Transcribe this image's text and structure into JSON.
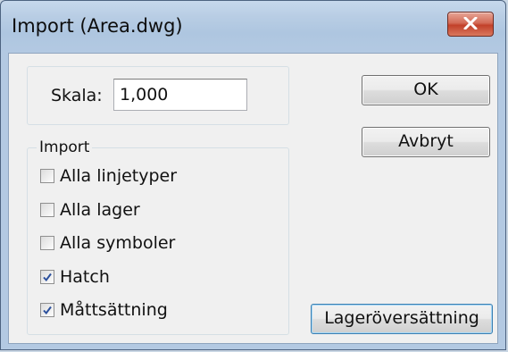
{
  "window": {
    "title": "Import (Area.dwg)"
  },
  "scale": {
    "label": "Skala:",
    "value": "1,000"
  },
  "import_group": {
    "legend": "Import",
    "options": [
      {
        "label": "Alla linjetyper",
        "checked": false
      },
      {
        "label": "Alla lager",
        "checked": false
      },
      {
        "label": "Alla symboler",
        "checked": false
      },
      {
        "label": "Hatch",
        "checked": true
      },
      {
        "label": "Måttsättning",
        "checked": true
      }
    ]
  },
  "buttons": {
    "ok": "OK",
    "cancel": "Avbryt",
    "layer_mapping": "Lageröversättning"
  },
  "icons": {
    "close": "close-icon",
    "check": "checkmark-icon"
  },
  "colors": {
    "close_button": "#c7432d",
    "check": "#2a4f9c",
    "accent_border": "#3c7fb1"
  }
}
